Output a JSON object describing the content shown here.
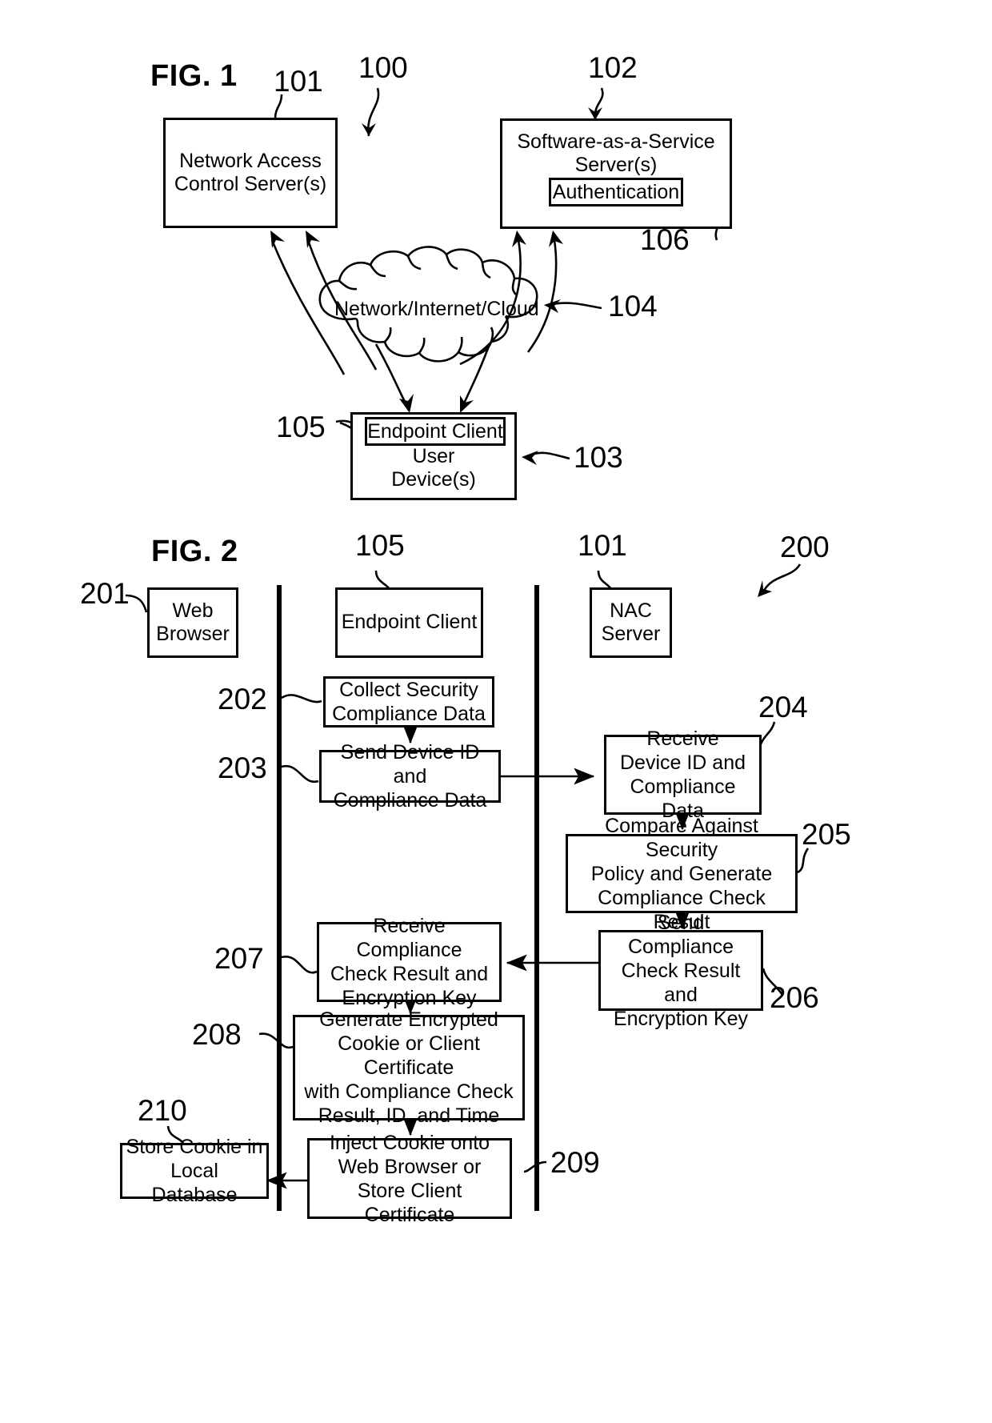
{
  "figure1": {
    "title": "FIG. 1",
    "system_ref": "100",
    "nodes": [
      {
        "id": "nac",
        "label": "Network Access\nControl Server(s)",
        "ref": "101"
      },
      {
        "id": "saas",
        "label": "Software-as-a-Service\nServer(s)",
        "ref": "102"
      },
      {
        "id": "auth",
        "label": "Authentication",
        "ref": "106"
      },
      {
        "id": "cloud",
        "label": "Network/Internet/Cloud",
        "ref": "104"
      },
      {
        "id": "endpoint",
        "label": "Endpoint Client",
        "ref": "105"
      },
      {
        "id": "device",
        "label": "User\nDevice(s)",
        "ref": "103"
      }
    ]
  },
  "figure2": {
    "title": "FIG. 2",
    "system_ref": "200",
    "actors": [
      {
        "id": "web-browser",
        "label": "Web\nBrowser",
        "ref": "201"
      },
      {
        "id": "endpoint-client",
        "label": "Endpoint Client",
        "ref": "105"
      },
      {
        "id": "nac-server",
        "label": "NAC\nServer",
        "ref": "101"
      }
    ],
    "steps": [
      {
        "ref": "202",
        "label": "Collect Security\nCompliance Data"
      },
      {
        "ref": "203",
        "label": "Send Device ID and\nCompliance Data"
      },
      {
        "ref": "204",
        "label": "Receive\nDevice ID and\nCompliance Data"
      },
      {
        "ref": "205",
        "label": "Compare Against Security\nPolicy and Generate\nCompliance Check Result"
      },
      {
        "ref": "206",
        "label": "Send Compliance\nCheck Result and\nEncryption Key"
      },
      {
        "ref": "207",
        "label": "Receive Compliance\nCheck Result and\nEncryption Key"
      },
      {
        "ref": "208",
        "label": "Generate Encrypted\nCookie or Client Certificate\nwith Compliance Check\nResult, ID, and Time"
      },
      {
        "ref": "209",
        "label": "Inject Cookie onto\nWeb Browser or\nStore Client Certificate"
      },
      {
        "ref": "210",
        "label": "Store Cookie in\nLocal Database"
      }
    ]
  },
  "colors": {
    "ink": "#000000",
    "paper": "#ffffff"
  }
}
